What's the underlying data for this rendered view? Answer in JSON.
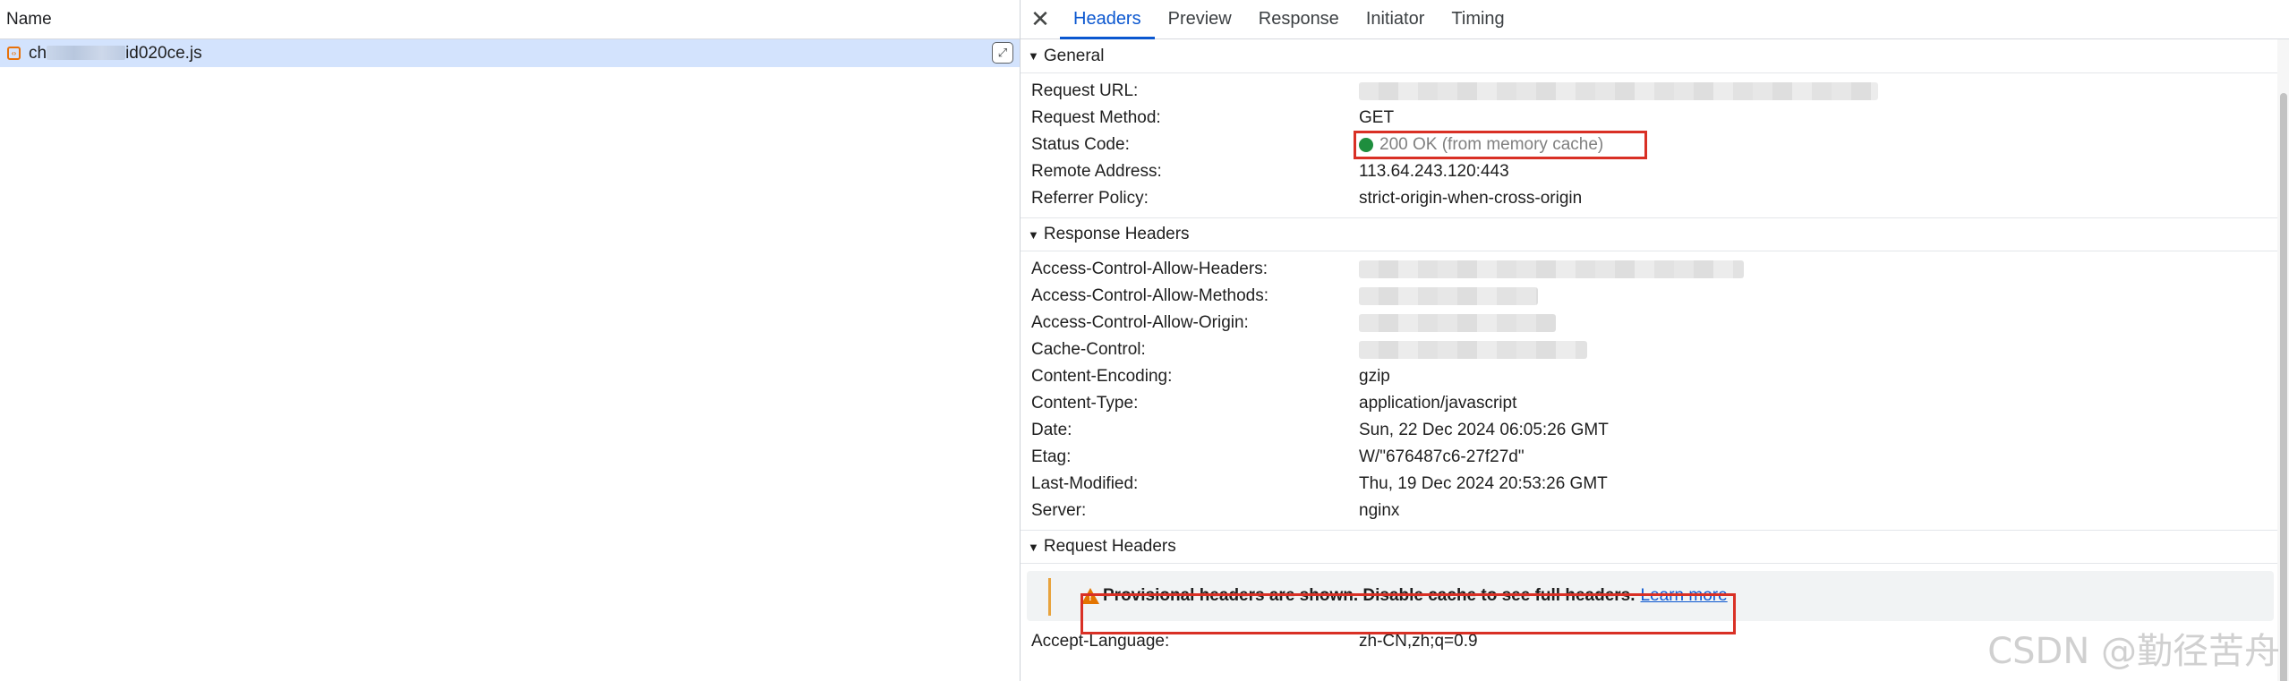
{
  "left": {
    "column_header": "Name",
    "request": {
      "name_prefix": "ch",
      "name_suffix": "id020ce.js"
    }
  },
  "tabs": [
    {
      "label": "Headers"
    },
    {
      "label": "Preview"
    },
    {
      "label": "Response"
    },
    {
      "label": "Initiator"
    },
    {
      "label": "Timing"
    }
  ],
  "general": {
    "title": "General",
    "request_url_label": "Request URL:",
    "request_method_label": "Request Method:",
    "request_method": "GET",
    "status_code_label": "Status Code:",
    "status_code": "200 OK (from memory cache)",
    "remote_address_label": "Remote Address:",
    "remote_address": "113.64.243.120:443",
    "referrer_policy_label": "Referrer Policy:",
    "referrer_policy": "strict-origin-when-cross-origin"
  },
  "response_headers": {
    "title": "Response Headers",
    "acah_label": "Access-Control-Allow-Headers:",
    "acam_label": "Access-Control-Allow-Methods:",
    "acao_label": "Access-Control-Allow-Origin:",
    "cache_control_label": "Cache-Control:",
    "content_encoding_label": "Content-Encoding:",
    "content_encoding": "gzip",
    "content_type_label": "Content-Type:",
    "content_type": "application/javascript",
    "date_label": "Date:",
    "date": "Sun, 22 Dec 2024 06:05:26 GMT",
    "etag_label": "Etag:",
    "etag": "W/\"676487c6-27f27d\"",
    "last_modified_label": "Last-Modified:",
    "last_modified": "Thu, 19 Dec 2024 20:53:26 GMT",
    "server_label": "Server:",
    "server": "nginx"
  },
  "request_headers": {
    "title": "Request Headers",
    "warning": "Provisional headers are shown. Disable cache to see full headers.",
    "learn_more": "Learn more",
    "accept_language_label": "Accept-Language:",
    "accept_language": "zh-CN,zh;q=0.9"
  },
  "watermark": "CSDN @勤径苦舟",
  "colors": {
    "accent": "#0b57d0",
    "status_ok": "#1e8e3e",
    "highlight_box": "#d93025",
    "warning": "#e37400",
    "selected_row": "#d3e3fd"
  }
}
